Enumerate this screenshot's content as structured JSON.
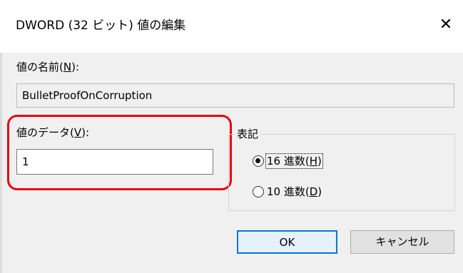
{
  "dialog": {
    "title": "DWORD (32 ビット) 値の編集",
    "close_icon": "close-icon"
  },
  "value_name": {
    "label_text": "値の名前(",
    "label_accesskey": "N",
    "label_suffix": "):",
    "value": "BulletProofOnCorruption"
  },
  "value_data": {
    "label_text": "値のデータ(",
    "label_accesskey": "V",
    "label_suffix": "):",
    "value": "1",
    "highlight_color": "#e60012"
  },
  "base": {
    "legend": "表記",
    "options": [
      {
        "prefix": "16 進数(",
        "accesskey": "H",
        "suffix": ")",
        "selected": true
      },
      {
        "prefix": "10 進数(",
        "accesskey": "D",
        "suffix": ")",
        "selected": false
      }
    ]
  },
  "buttons": {
    "ok_label": "OK",
    "cancel_label": "キャンセル",
    "accent": "#0078d7"
  }
}
